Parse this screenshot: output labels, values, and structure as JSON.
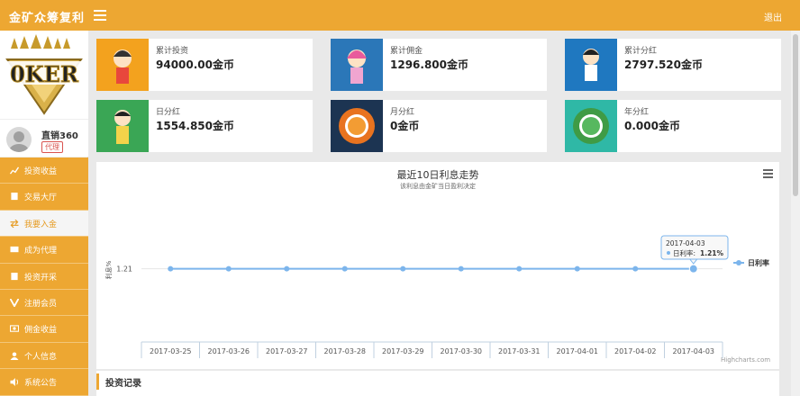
{
  "header": {
    "brand": "金矿众筹复利",
    "logout_label": "退出"
  },
  "sidebar": {
    "user": {
      "name": "直销360",
      "badge": "代理"
    },
    "items": [
      {
        "label": "投资收益",
        "icon": "chart-icon"
      },
      {
        "label": "交易大厅",
        "icon": "doc-icon"
      },
      {
        "label": "我要入金",
        "icon": "exchange-icon",
        "active": true
      },
      {
        "label": "成为代理",
        "icon": "mail-icon"
      },
      {
        "label": "投资开采",
        "icon": "doc-icon"
      },
      {
        "label": "注册会员",
        "icon": "v-icon"
      },
      {
        "label": "佣金收益",
        "icon": "money-icon"
      },
      {
        "label": "个人信息",
        "icon": "user-icon"
      },
      {
        "label": "系统公告",
        "icon": "sound-icon"
      }
    ]
  },
  "cards": [
    {
      "label": "累计投资",
      "value": "94000.00金币",
      "color": "#f3a21e"
    },
    {
      "label": "累计佣金",
      "value": "1296.800金币",
      "color": "#2b77b8"
    },
    {
      "label": "累计分红",
      "value": "2797.520金币",
      "color": "#1f78c0"
    },
    {
      "label": "日分红",
      "value": "1554.850金币",
      "color": "#3aa655"
    },
    {
      "label": "月分红",
      "value": "0金币",
      "color": "#1c3452"
    },
    {
      "label": "年分红",
      "value": "0.000金币",
      "color": "#2fb8a6"
    }
  ],
  "chart": {
    "title": "最近10日利息走势",
    "subtitle": "该利息由金矿当日盈利决定",
    "credit": "Highcharts.com",
    "tooltip": {
      "date": "2017-04-03",
      "series": "日利率",
      "value": "1.21%"
    }
  },
  "chart_data": {
    "type": "line",
    "title": "最近10日利息走势",
    "subtitle": "该利息由金矿当日盈利决定",
    "ylabel": "利息%",
    "x": [
      "2017-03-25",
      "2017-03-26",
      "2017-03-27",
      "2017-03-28",
      "2017-03-29",
      "2017-03-30",
      "2017-03-31",
      "2017-04-01",
      "2017-04-02",
      "2017-04-03"
    ],
    "series": [
      {
        "name": "日利率",
        "values": [
          1.21,
          1.21,
          1.21,
          1.21,
          1.21,
          1.21,
          1.21,
          1.21,
          1.21,
          1.21
        ]
      }
    ],
    "yticks": [
      "1.21"
    ],
    "legend": "right",
    "grid": true,
    "color": "#7cb5ec"
  },
  "bottom": {
    "title": "投资记录"
  }
}
